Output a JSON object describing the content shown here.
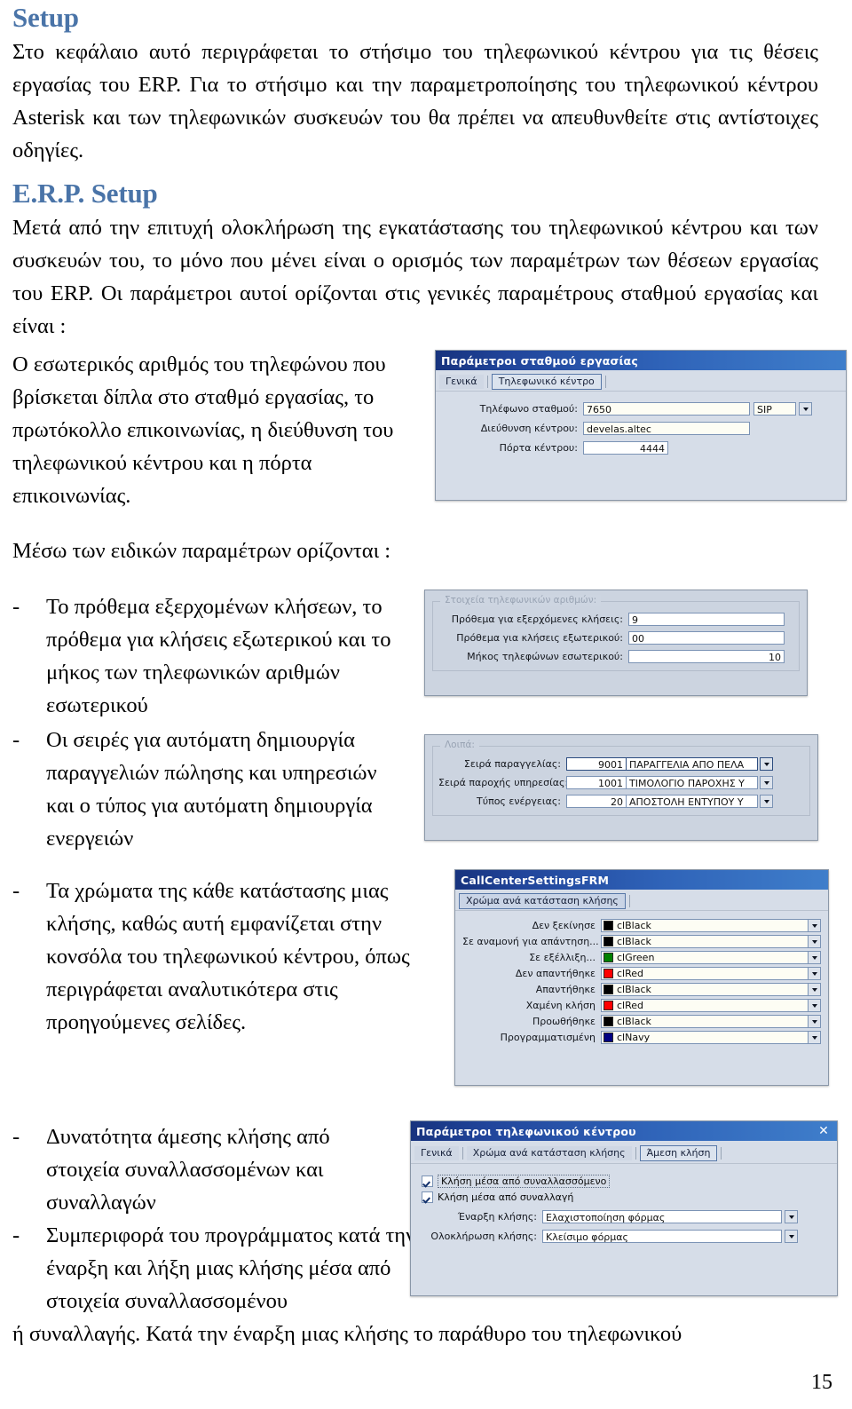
{
  "page": {
    "number": "15"
  },
  "sections": {
    "setup": {
      "heading": "Setup",
      "paragraph": "Στο κεφάλαιο αυτό περιγράφεται το στήσιμο του τηλεφωνικού κέντρου για τις θέσεις εργασίας του ERP. Για το στήσιμο και την παραμετροποίησης του τηλεφωνικού κέντρου Asterisk και των τηλεφωνικών συσκευών του θα πρέπει να απευθυνθείτε στις αντίστοιχες οδηγίες."
    },
    "erp_setup": {
      "heading": "E.R.P. Setup",
      "paragraph": "Μετά από την επιτυχή ολοκλήρωση της εγκατάστασης του τηλεφωνικού κέντρου και των συσκευών του, το μόνο που μένει είναι ο ορισμός των παραμέτρων των θέσεων εργασίας του ERP. Οι παράμετροι αυτοί ορίζονται στις γενικές παραμέτρους σταθμού εργασίας και είναι :",
      "description": "Ο εσωτερικός αριθμός του τηλεφώνου που βρίσκεται δίπλα στο σταθμό εργασίας, το πρωτόκολλο επικοινωνίας, η διεύθυνση του τηλεφωνικού κέντρου και η πόρτα επικοινωνίας."
    },
    "special_params": {
      "intro": "Μέσω των ειδικών παραμέτρων ορίζονται :",
      "bullets": [
        {
          "dash": "-",
          "text": "Το πρόθεμα εξερχομένων κλήσεων, το πρόθεμα για κλήσεις εξωτερικού και το μήκος των τηλεφωνικών αριθμών εσωτερικού"
        },
        {
          "dash": "-",
          "text": "Οι σειρές για αυτόματη δημιουργία παραγγελιών πώλησης και υπηρεσιών και ο τύπος για αυτόματη δημιουργία ενεργειών"
        },
        {
          "dash": "-",
          "text": "Τα χρώματα της κάθε κατάστασης μιας κλήσης, καθώς αυτή εμφανίζεται στην κονσόλα του τηλεφωνικού κέντρου, όπως περιγράφεται αναλυτικότερα στις προηγούμενες σελίδες."
        },
        {
          "dash": "-",
          "text": "Δυνατότητα άμεσης κλήσης από στοιχεία συναλλασσομένων και συναλλαγών"
        },
        {
          "dash": "-",
          "text": "Συμπεριφορά του προγράμματος κατά την έναρξη και λήξη μιας κλήσης μέσα από στοιχεία συναλλασσομένου"
        }
      ],
      "closing": "ή συναλλαγής. Κατά την έναρξη μιας κλήσης το παράθυρο του τηλεφωνικού"
    }
  },
  "dialog_workstation": {
    "title": "Παράμετροι σταθμού εργασίας",
    "tabs": [
      {
        "label": "Γενικά",
        "style": "plain"
      },
      {
        "label": "Τηλεφωνικό κέντρο",
        "style": "boxed"
      }
    ],
    "fields": [
      {
        "label": "Τηλέφωνο σταθμού:",
        "value": "7650",
        "align": "left",
        "combo_value": "SIP"
      },
      {
        "label": "Διεύθυνση κέντρου:",
        "value": "develas.altec",
        "align": "left"
      },
      {
        "label": "Πόρτα κέντρου:",
        "value": "4444",
        "align": "right"
      }
    ]
  },
  "dialog_phone_numbers": {
    "group_caption": "Στοιχεία τηλεφωνικών αριθμών:",
    "fields": [
      {
        "label": "Πρόθεμα για εξερχόμενες κλήσεις:",
        "value": "9",
        "align": "left"
      },
      {
        "label": "Πρόθεμα για κλήσεις εξωτερικού:",
        "value": "00",
        "align": "left"
      },
      {
        "label": "Μήκος τηλεφώνων εσωτερικού:",
        "value": "10",
        "align": "right"
      }
    ]
  },
  "dialog_misc": {
    "group_caption": "Λοιπά:",
    "fields": [
      {
        "label": "Σειρά παραγγελίας:",
        "code": "9001",
        "desc": "ΠΑΡΑΓΓΕΛΙΑ ΑΠΟ ΠΕΛΑ"
      },
      {
        "label": "Σειρά παροχής υπηρεσίας:",
        "code": "1001",
        "desc": "ΤΙΜΟΛΟΓΙΟ ΠΑΡΟΧΗΣ Υ"
      },
      {
        "label": "Τύπος ενέργειας:",
        "code": "20",
        "desc": "ΑΠΟΣΤΟΛΗ ΕΝΤΥΠΟΥ Υ"
      }
    ]
  },
  "dialog_callcenter_settings": {
    "title": "CallCenterSettingsFRM",
    "tabs": [
      {
        "label": "Χρώμα ανά κατάσταση κλήσης",
        "style": "sel"
      }
    ],
    "color_rows": [
      {
        "label": "Δεν ξεκίνησε",
        "color_name": "clBlack",
        "hex": "#000000"
      },
      {
        "label": "Σε αναμονή για απάντηση...",
        "color_name": "clBlack",
        "hex": "#000000"
      },
      {
        "label": "Σε εξέλλιξη...",
        "color_name": "clGreen",
        "hex": "#008000"
      },
      {
        "label": "Δεν απαντήθηκε",
        "color_name": "clRed",
        "hex": "#ff0000"
      },
      {
        "label": "Απαντήθηκε",
        "color_name": "clBlack",
        "hex": "#000000"
      },
      {
        "label": "Χαμένη κλήση",
        "color_name": "clRed",
        "hex": "#ff0000"
      },
      {
        "label": "Προωθήθηκε",
        "color_name": "clBlack",
        "hex": "#000000"
      },
      {
        "label": "Προγραμματισμένη",
        "color_name": "clNavy",
        "hex": "#000080"
      }
    ]
  },
  "dialog_callcenter_params": {
    "title": "Παράμετροι τηλεφωνικού κέντρου",
    "close_label": "✕",
    "tabs": [
      {
        "label": "Γενικά",
        "style": "plain"
      },
      {
        "label": "Χρώμα ανά κατάσταση κλήσης",
        "style": "plain"
      },
      {
        "label": "Άμεση κλήση",
        "style": "boxed"
      }
    ],
    "checkboxes": [
      {
        "label": "Κλήση μέσα από συναλλασσόμενο",
        "checked": true,
        "focused": true
      },
      {
        "label": "Κλήση μέσα από συναλλαγή",
        "checked": true,
        "focused": false
      }
    ],
    "fields": [
      {
        "label": "Έναρξη κλήσης:",
        "value": "Ελαχιστοποίηση φόρμας"
      },
      {
        "label": "Ολοκλήρωση κλήσης:",
        "value": "Κλείσιμο φόρμας"
      }
    ]
  }
}
